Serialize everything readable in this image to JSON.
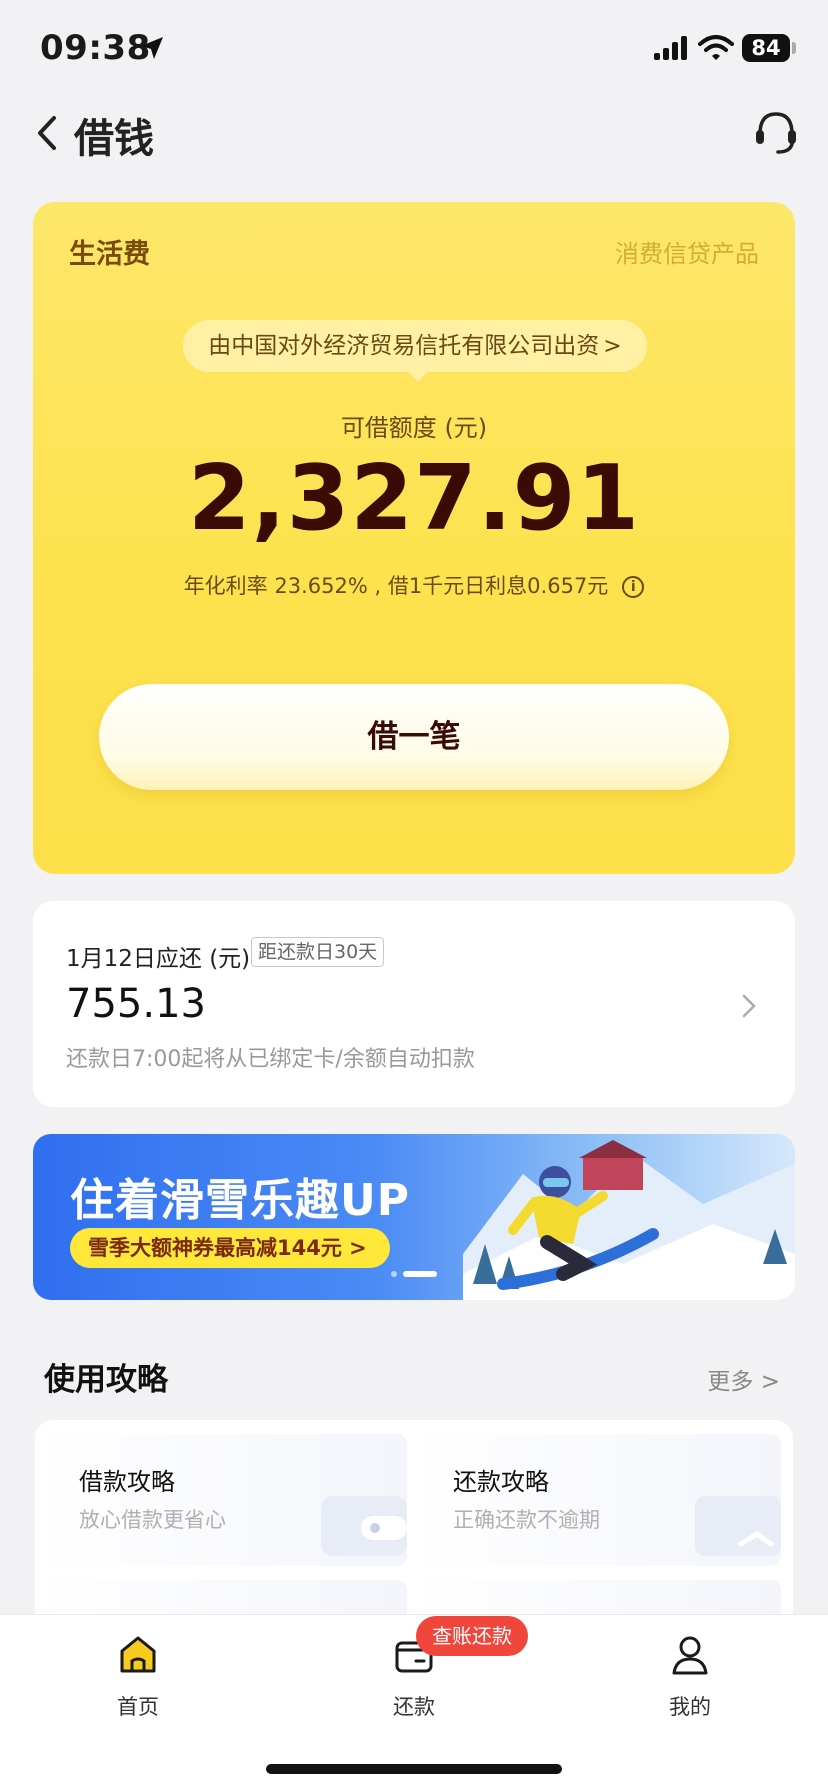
{
  "status_bar": {
    "time": "09:38",
    "battery": "84"
  },
  "nav": {
    "title": "借钱"
  },
  "loan_card": {
    "product_name": "生活费",
    "product_type": "消费信贷产品",
    "funder_text": "由中国对外经济贸易信托有限公司出资",
    "funder_arrow": ">",
    "quota_label": "可借额度 (元)",
    "quota_amount": "2,327.91",
    "rate_text": "年化利率  23.652% , 借1千元日利息0.657元",
    "info_icon_glyph": "i",
    "borrow_button": "借一笔"
  },
  "repayment": {
    "due_label": "1月12日应还 (元)",
    "days_badge": "距还款日30天",
    "amount": "755.13",
    "note": "还款日7:00起将从已绑定卡/余额自动扣款"
  },
  "banner": {
    "title": "住着滑雪乐趣UP",
    "coupon_text": "雪季大额神券最高减144元 >"
  },
  "guides": {
    "title": "使用攻略",
    "more": "更多 >",
    "items": [
      {
        "title": "借款攻略",
        "subtitle": "放心借款更省心"
      },
      {
        "title": "还款攻略",
        "subtitle": "正确还款不逾期"
      }
    ]
  },
  "tab_bar": {
    "items": [
      {
        "label": "首页",
        "icon": "home-icon",
        "active": true
      },
      {
        "label": "还款",
        "icon": "wallet-icon",
        "active": false
      },
      {
        "label": "我的",
        "icon": "user-icon",
        "active": false
      }
    ],
    "badge": "查账还款"
  },
  "colors": {
    "card_yellow": "#fde24e",
    "amount_dark": "#3a0b04",
    "badge_red": "#f0463c",
    "active_tab": "#f7cc1f"
  }
}
